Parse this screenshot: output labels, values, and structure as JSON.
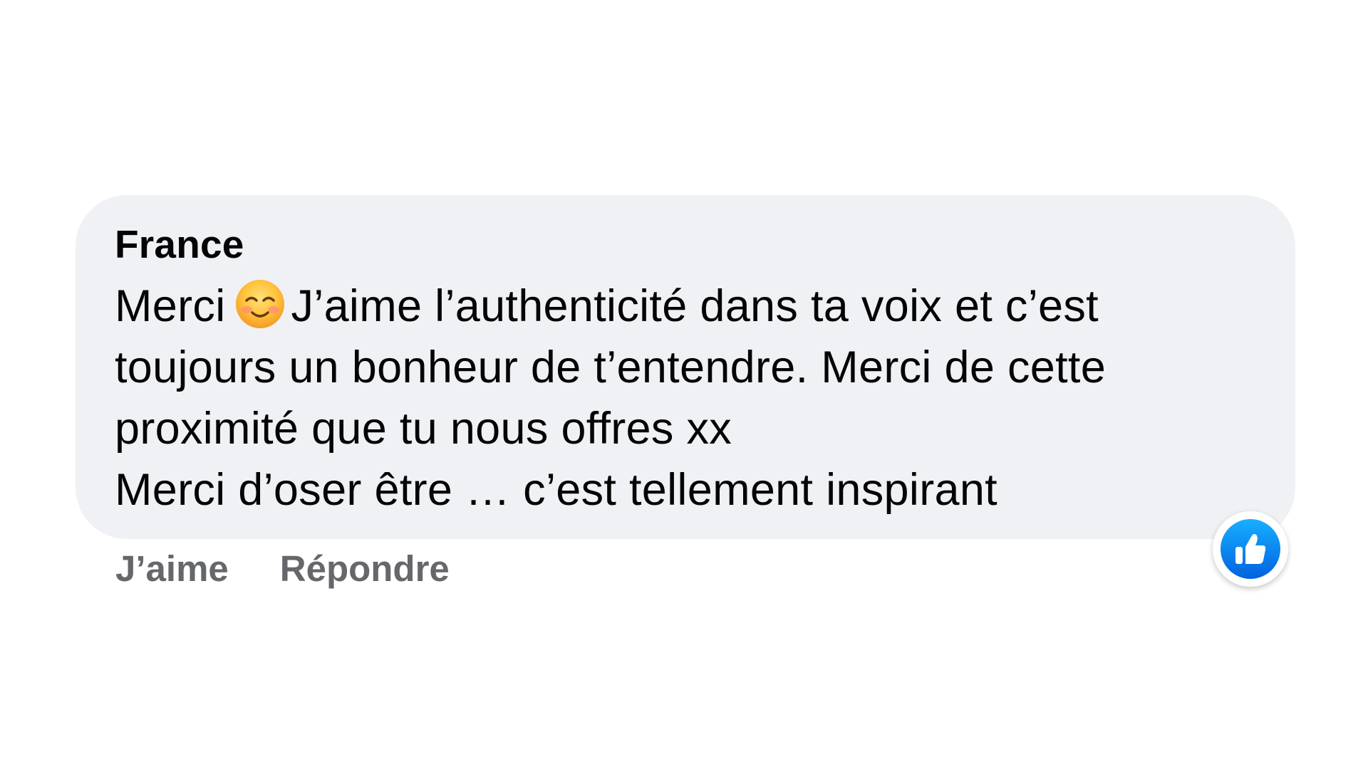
{
  "comment": {
    "author": "France",
    "lines": {
      "l1_before": "Merci",
      "l1_emoji": "smiling-face-with-smiling-eyes-emoji",
      "l1_after": "J’aime l’authenticité dans ta voix et c’est",
      "l2": "toujours un bonheur de t’entendre. Merci de cette",
      "l3": "proximité que tu nous offres xx",
      "l4": "Merci d’oser être … c’est tellement inspirant"
    }
  },
  "actions": {
    "like_label": "J’aime",
    "reply_label": "Répondre"
  },
  "reaction": {
    "icon": "thumbs-up-icon",
    "color": "#1877f2"
  },
  "colors": {
    "bubble_bg": "#f0f1f4",
    "text": "#050505",
    "action_text": "#65676b"
  }
}
